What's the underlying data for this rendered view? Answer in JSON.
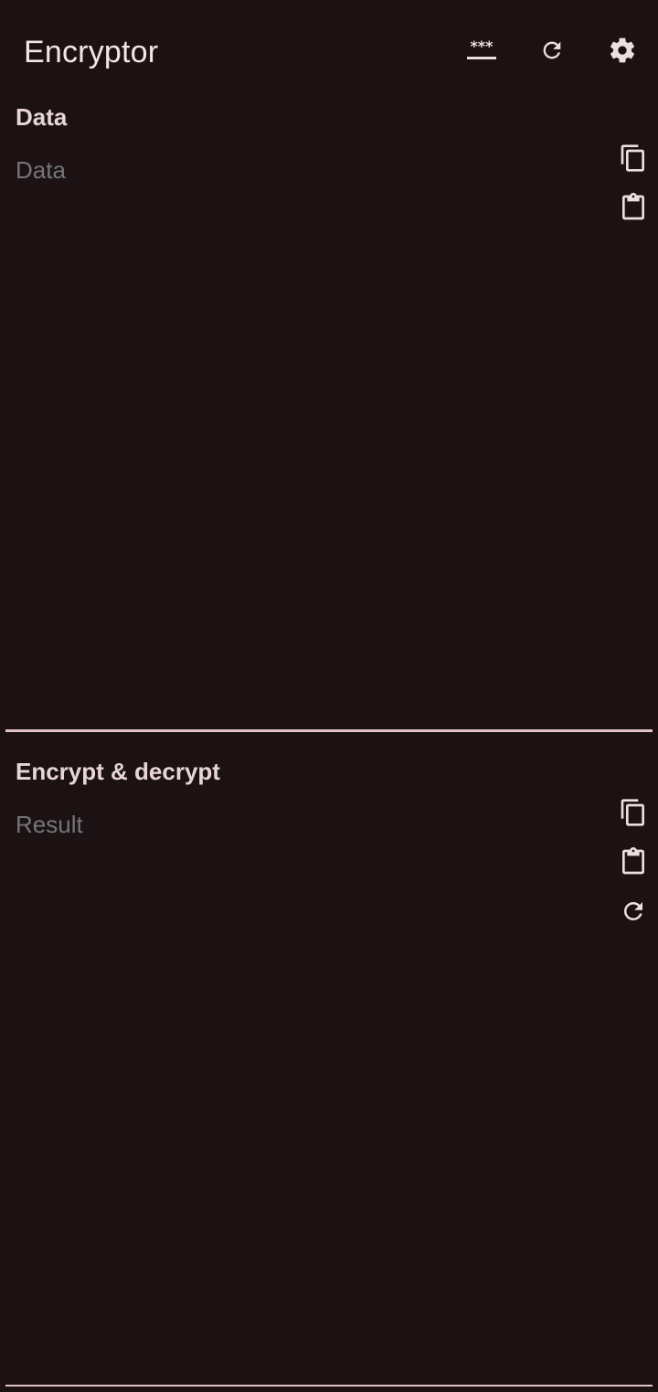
{
  "app_bar": {
    "title": "Encryptor",
    "actions": [
      {
        "icon": "password-icon",
        "glyph": "***"
      },
      {
        "icon": "refresh-icon"
      },
      {
        "icon": "gear-icon"
      }
    ]
  },
  "data_section": {
    "title": "Data",
    "field_placeholder": "Data",
    "field_value": "",
    "actions": [
      "copy-icon",
      "paste-icon"
    ]
  },
  "result_section": {
    "title": "Encrypt & decrypt",
    "field_placeholder": "Result",
    "field_value": "",
    "actions": [
      "copy-icon",
      "paste-icon",
      "refresh-icon"
    ]
  },
  "colors": {
    "background": "#1c1213",
    "text": "#ecdfe0",
    "hint": "#9b8d8f",
    "divider": "#e3c4c6"
  }
}
